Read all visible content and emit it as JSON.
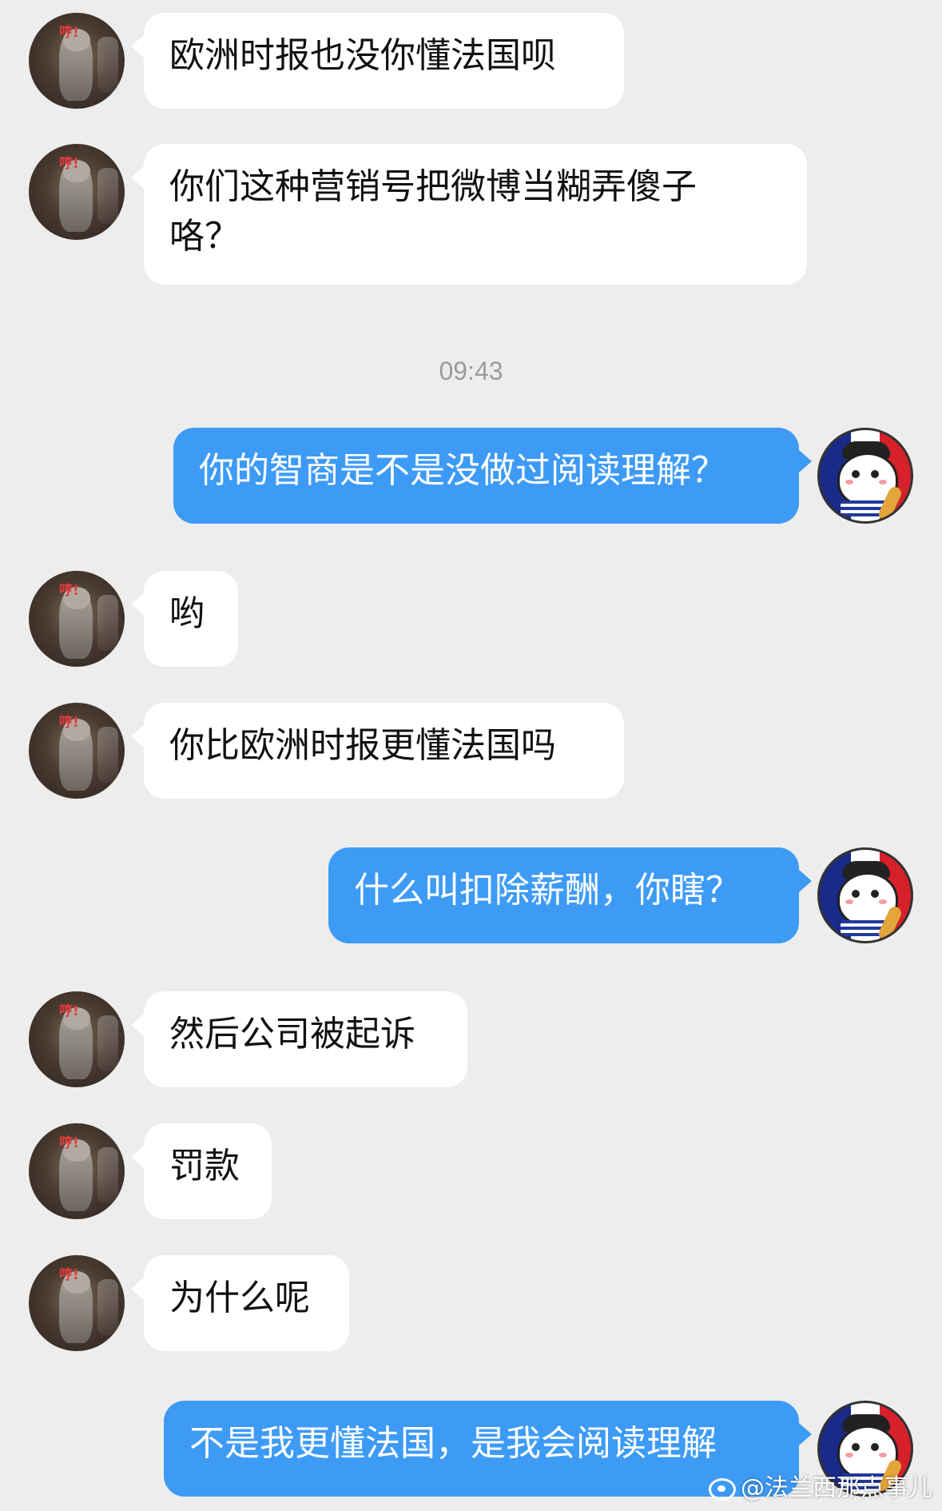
{
  "timestamp": "09:43",
  "messages": [
    {
      "side": "left",
      "text": "欧洲时报也没你懂法国呗"
    },
    {
      "side": "left",
      "text": "你们这种营销号把微博当糊弄傻子\n咯？"
    },
    {
      "side": "right",
      "text": "你的智商是不是没做过阅读理解？"
    },
    {
      "side": "left",
      "text": "哟"
    },
    {
      "side": "left",
      "text": "你比欧洲时报更懂法国吗"
    },
    {
      "side": "right",
      "text": "什么叫扣除薪酬，你瞎？"
    },
    {
      "side": "left",
      "text": "然后公司被起诉"
    },
    {
      "side": "left",
      "text": "罚款"
    },
    {
      "side": "left",
      "text": "为什么呢"
    },
    {
      "side": "right",
      "text": "不是我更懂法国，是我会阅读理解"
    }
  ],
  "avatar_badge": "哼!",
  "watermark": "@法兰西那点事儿",
  "colors": {
    "background": "#ededed",
    "incoming_bubble": "#ffffff",
    "outgoing_bubble": "#3d9bf6",
    "timestamp_text": "#9b9b9b"
  },
  "icons": {
    "incoming_avatar": "cat-avatar-icon",
    "outgoing_avatar": "french-flag-cat-avatar-icon",
    "watermark_logo": "weibo-icon"
  }
}
